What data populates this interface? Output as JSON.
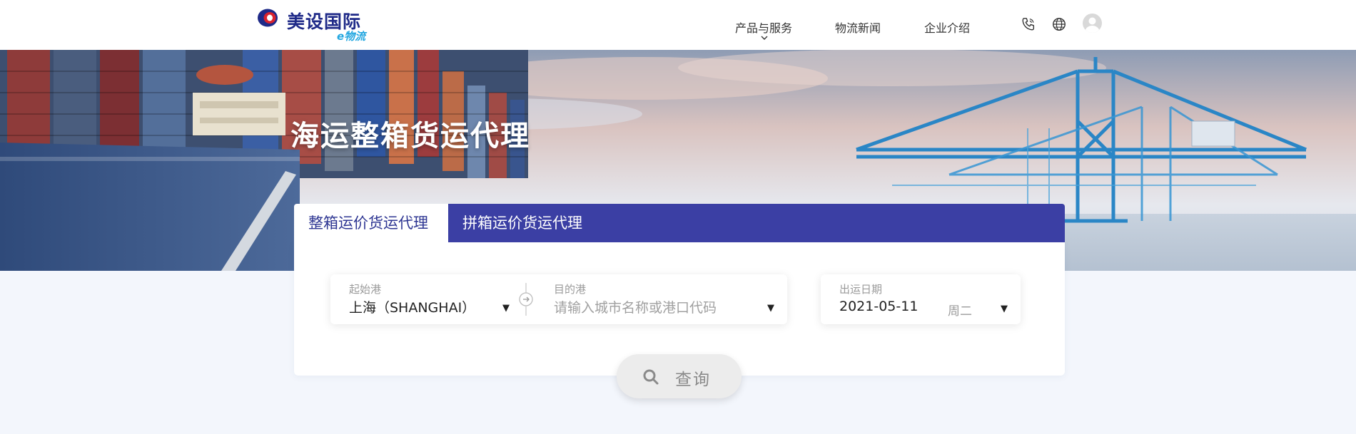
{
  "brand": {
    "name": "美设国际",
    "sub": "e物流",
    "colors": {
      "navy": "#1f2a88",
      "red": "#d9232e",
      "cyan": "#24a7e0"
    }
  },
  "nav": {
    "products": "产品与服务",
    "news": "物流新闻",
    "about": "企业介绍"
  },
  "header_icons": [
    "phone-icon",
    "globe-icon",
    "avatar-icon"
  ],
  "hero": {
    "title": "海运整箱货运代理"
  },
  "tabs": [
    {
      "label": "整箱运价货运代理",
      "active": true
    },
    {
      "label": "拼箱运价货运代理",
      "active": false
    }
  ],
  "search": {
    "origin_label": "起始港",
    "origin_value": "上海（SHANGHAI）",
    "dest_label": "目的港",
    "dest_placeholder": "请输入城市名称或港口代码",
    "date_label": "出运日期",
    "date_value": "2021-05-11",
    "weekday": "周二",
    "button_label": "查询"
  },
  "colors": {
    "tab_bar": "#3b3fa4",
    "page_bg": "#f3f6fc",
    "header_bg": "#ffffff"
  }
}
